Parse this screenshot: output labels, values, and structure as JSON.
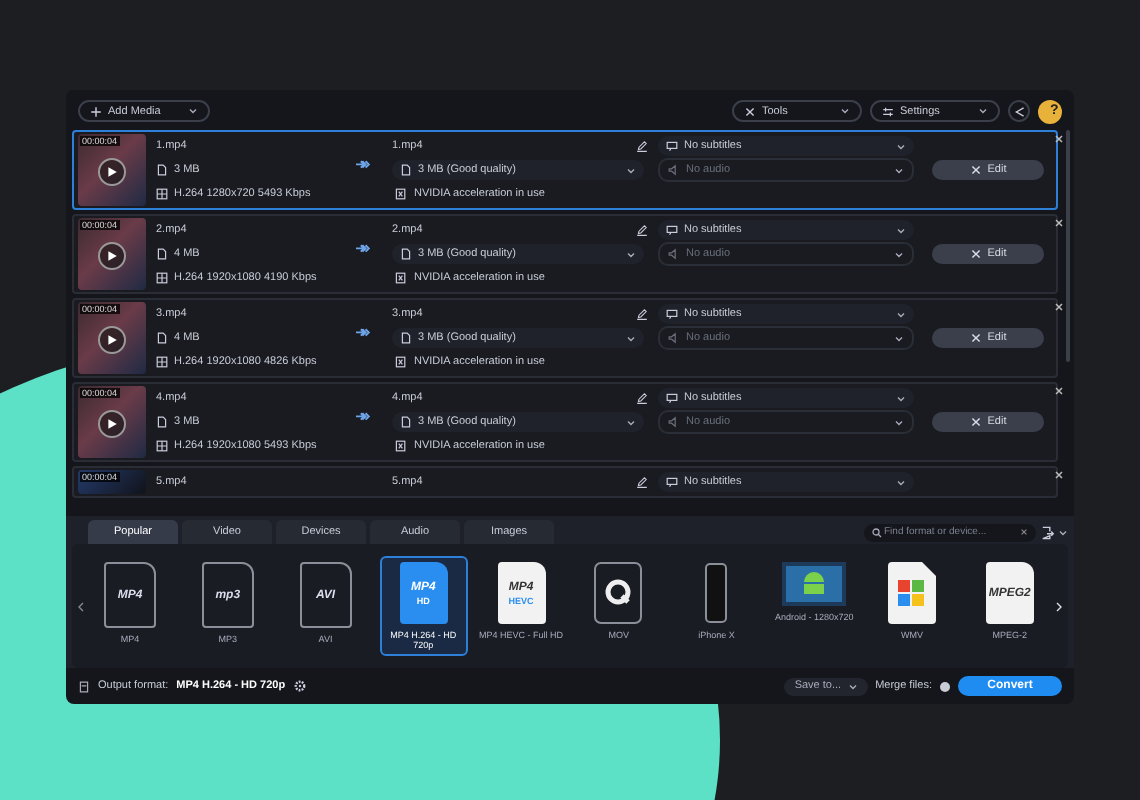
{
  "toolbar": {
    "add_media": "Add Media",
    "tools": "Tools",
    "settings": "Settings",
    "help": "?"
  },
  "files": [
    {
      "time": "00:00:04",
      "name": "1.mp4",
      "size": "3 MB",
      "info": "H.264 1280x720 5493 Kbps",
      "output": "1.mp4",
      "quality": "3 MB (Good quality)",
      "acceleration": "NVIDIA acceleration in use",
      "subtitles": "No subtitles",
      "audio": "No audio",
      "edit": "Edit",
      "selected": true
    },
    {
      "time": "00:00:04",
      "name": "2.mp4",
      "size": "4 MB",
      "info": "H.264 1920x1080 4190 Kbps",
      "output": "2.mp4",
      "quality": "3 MB (Good quality)",
      "acceleration": "NVIDIA acceleration in use",
      "subtitles": "No subtitles",
      "audio": "No audio",
      "edit": "Edit",
      "selected": false
    },
    {
      "time": "00:00:04",
      "name": "3.mp4",
      "size": "4 MB",
      "info": "H.264 1920x1080 4826 Kbps",
      "output": "3.mp4",
      "quality": "3 MB (Good quality)",
      "acceleration": "NVIDIA acceleration in use",
      "subtitles": "No subtitles",
      "audio": "No audio",
      "edit": "Edit",
      "selected": false
    },
    {
      "time": "00:00:04",
      "name": "4.mp4",
      "size": "3 MB",
      "info": "H.264 1920x1080 5493 Kbps",
      "output": "4.mp4",
      "quality": "3 MB (Good quality)",
      "acceleration": "NVIDIA acceleration in use",
      "subtitles": "No subtitles",
      "audio": "No audio",
      "edit": "Edit",
      "selected": false
    },
    {
      "time": "00:00:04",
      "name": "5.mp4",
      "output": "5.mp4",
      "subtitles": "No subtitles",
      "selected": false
    }
  ],
  "format_panel": {
    "tabs": [
      {
        "label": "Popular",
        "selected": true
      },
      {
        "label": "Video",
        "selected": false
      },
      {
        "label": "Devices",
        "selected": false
      },
      {
        "label": "Audio",
        "selected": false
      },
      {
        "label": "Images",
        "selected": false
      }
    ],
    "search": {
      "placeholder": "Find format or device..."
    },
    "formats": [
      {
        "kind": "doc-outline",
        "icon_text": "MP4",
        "label": "MP4",
        "selected": false
      },
      {
        "kind": "doc-outline",
        "icon_text": "mp3",
        "label": "MP3",
        "selected": false
      },
      {
        "kind": "doc-outline",
        "icon_text": "AVI",
        "label": "AVI",
        "selected": false
      },
      {
        "kind": "doc-blue",
        "icon_text": "MP4",
        "icon_subtext": "HD",
        "label": "MP4 H.264 - HD 720p",
        "selected": true
      },
      {
        "kind": "doc-white",
        "icon_text": "MP4",
        "icon_subtext": "HEVC",
        "label": "MP4 HEVC - Full HD",
        "selected": false
      },
      {
        "kind": "quicktime",
        "label": "MOV",
        "selected": false
      },
      {
        "kind": "phone",
        "label": "iPhone X",
        "selected": false
      },
      {
        "kind": "android",
        "label": "Android - 1280x720",
        "selected": false
      },
      {
        "kind": "windows",
        "label": "WMV",
        "selected": false
      },
      {
        "kind": "doc-white",
        "icon_text": "MPEG2",
        "label": "MPEG-2",
        "selected": false
      }
    ]
  },
  "bottom_bar": {
    "output_label": "Output format:",
    "output_value": "MP4 H.264 - HD 720p",
    "save_to": "Save to...",
    "merge_label": "Merge files:",
    "merge_on": false,
    "convert": "Convert"
  }
}
